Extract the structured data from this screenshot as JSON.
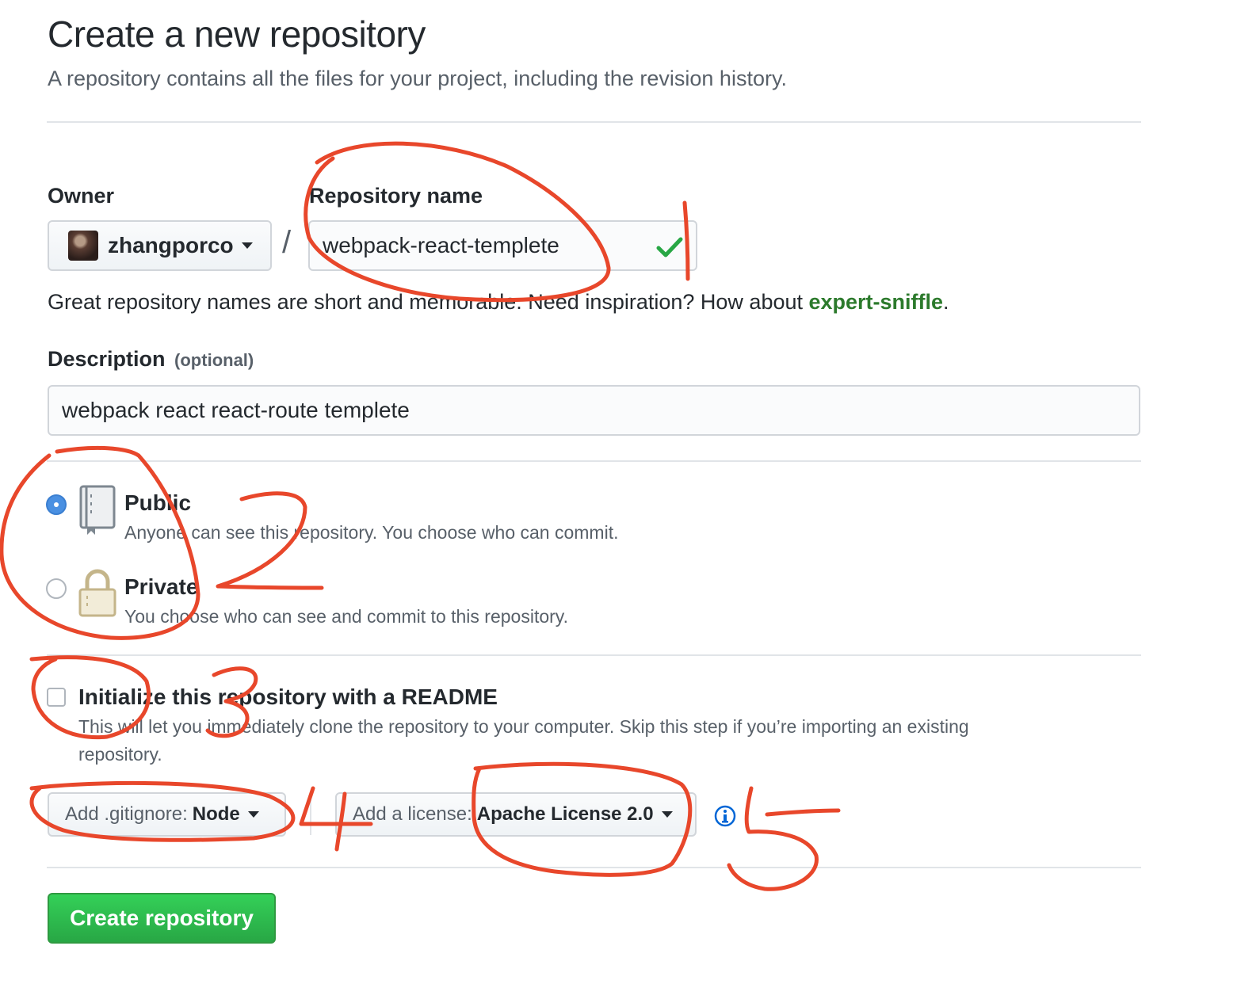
{
  "page": {
    "title": "Create a new repository",
    "subtitle": "A repository contains all the files for your project, including the revision history."
  },
  "owner": {
    "label": "Owner",
    "name": "zhangporco"
  },
  "repository": {
    "label": "Repository name",
    "value": "webpack-react-templete",
    "hint_prefix": "Great repository names are short and memorable. Need inspiration? How about ",
    "suggestion": "expert-sniffle",
    "hint_suffix": "."
  },
  "description": {
    "label": "Description",
    "optional": "(optional)",
    "value": "webpack react react-route templete"
  },
  "visibility": {
    "selected": "public",
    "public": {
      "title": "Public",
      "desc": "Anyone can see this repository. You choose who can commit."
    },
    "private": {
      "title": "Private",
      "desc": "You choose who can see and commit to this repository."
    }
  },
  "readme": {
    "checked": false,
    "title": "Initialize this repository with a README",
    "desc_line1": "This will let you immediately clone the repository to your computer. Skip this step if you’re importing an existing",
    "desc_line2": "repository."
  },
  "gitignore": {
    "prefix": "Add .gitignore:",
    "value": "Node"
  },
  "license": {
    "prefix": "Add a license:",
    "value": "Apache License 2.0"
  },
  "icons": {
    "avatar": "avatar",
    "caret": "caret-down-icon",
    "valid": "check-icon",
    "public": "repo-icon",
    "private": "lock-icon",
    "info": "info-icon"
  },
  "colors": {
    "primary_button": "#28a745",
    "suggestion_link": "#2c7a2c",
    "radio_selected": "#4a90e2",
    "annotation": "#e8472b"
  },
  "annotations": [
    "1",
    "2",
    "3",
    "4",
    "5"
  ],
  "submit": {
    "label": "Create repository"
  }
}
